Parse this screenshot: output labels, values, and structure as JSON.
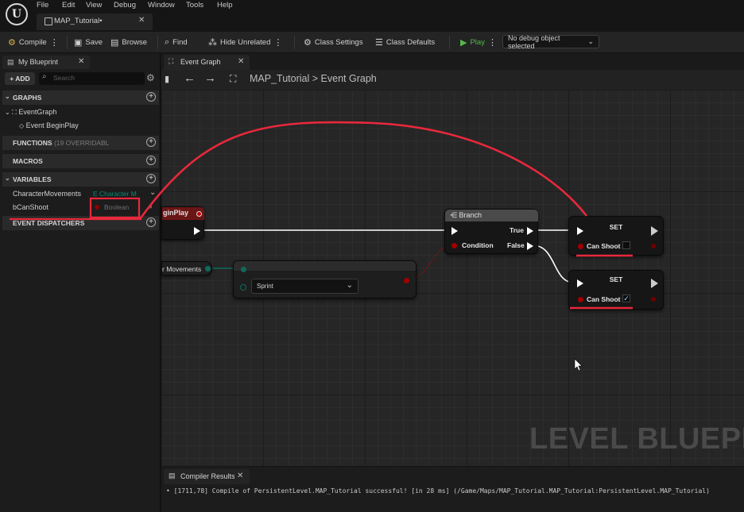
{
  "menu": [
    "File",
    "Edit",
    "View",
    "Debug",
    "Window",
    "Tools",
    "Help"
  ],
  "document_tab": {
    "title": "MAP_Tutorial•"
  },
  "toolbar": {
    "compile": "Compile",
    "save": "Save",
    "browse": "Browse",
    "find": "Find",
    "hide_unrelated": "Hide Unrelated",
    "class_settings": "Class Settings",
    "class_defaults": "Class Defaults",
    "play": "Play",
    "debug_object": "No debug object selected"
  },
  "left_panel": {
    "tab_label": "My Blueprint",
    "add_label": "ADD",
    "search_placeholder": "Search",
    "sections": {
      "graphs": "GRAPHS",
      "functions": "FUNCTIONS",
      "functions_sub": "(19 OVERRIDABL",
      "macros": "MACROS",
      "variables": "VARIABLES",
      "event_dispatchers": "EVENT DISPATCHERS"
    },
    "graph_items": {
      "event_graph": "EventGraph",
      "event_begin_play": "Event BeginPlay"
    },
    "variables": [
      {
        "name": "CharacterMovements",
        "type": "E Character M"
      },
      {
        "name": "bCanShoot",
        "type": "Boolean"
      }
    ]
  },
  "graph_tab": {
    "label": "Event Graph"
  },
  "breadcrumb": {
    "map": "MAP_Tutorial",
    "separator": ">",
    "graph": "Event Graph"
  },
  "nodes": {
    "begin_play": {
      "title": "ginPlay"
    },
    "char_movements_getter": {
      "label": "r Movements"
    },
    "switch_node": {
      "selected": "Sprint"
    },
    "branch": {
      "title": "Branch",
      "condition": "Condition",
      "true_label": "True",
      "false_label": "False"
    },
    "set_top": {
      "title": "SET",
      "pin_label": "Can Shoot",
      "checked": false
    },
    "set_bottom": {
      "title": "SET",
      "pin_label": "Can Shoot",
      "checked": true
    }
  },
  "watermark": "LEVEL BLUEPRI",
  "compiler": {
    "tab_label": "Compiler Results",
    "message": "[1711,78] Compile of PersistentLevel.MAP_Tutorial successful! [in 28 ms] (/Game/Maps/MAP_Tutorial.MAP_Tutorial:PersistentLevel.MAP_Tutorial)"
  },
  "colors": {
    "annotation_red": "#e8283c",
    "exec_wire": "#ffffff",
    "bool_pin": "#a00000",
    "enum_pin": "#0e6b5c",
    "play_green": "#56b84a"
  }
}
